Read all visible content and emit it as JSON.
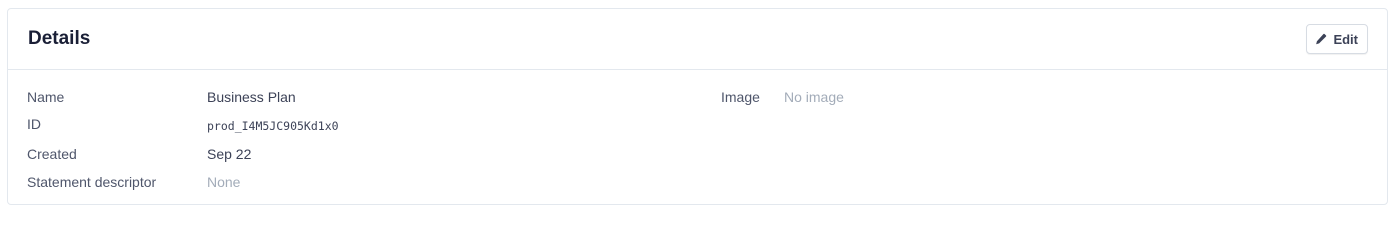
{
  "header": {
    "title": "Details",
    "edit_label": "Edit",
    "edit_icon": "pencil-icon"
  },
  "details": {
    "name_label": "Name",
    "name_value": "Business Plan",
    "id_label": "ID",
    "id_value": "prod_I4M5JC905Kd1x0",
    "created_label": "Created",
    "created_value": "Sep 22",
    "descriptor_label": "Statement descriptor",
    "descriptor_value": "None",
    "image_label": "Image",
    "image_value": "No image"
  },
  "colors": {
    "title": "#1a1f36",
    "label": "#4f566b",
    "value": "#3c4257",
    "muted": "#a3acb9",
    "border": "#e3e8ee"
  }
}
